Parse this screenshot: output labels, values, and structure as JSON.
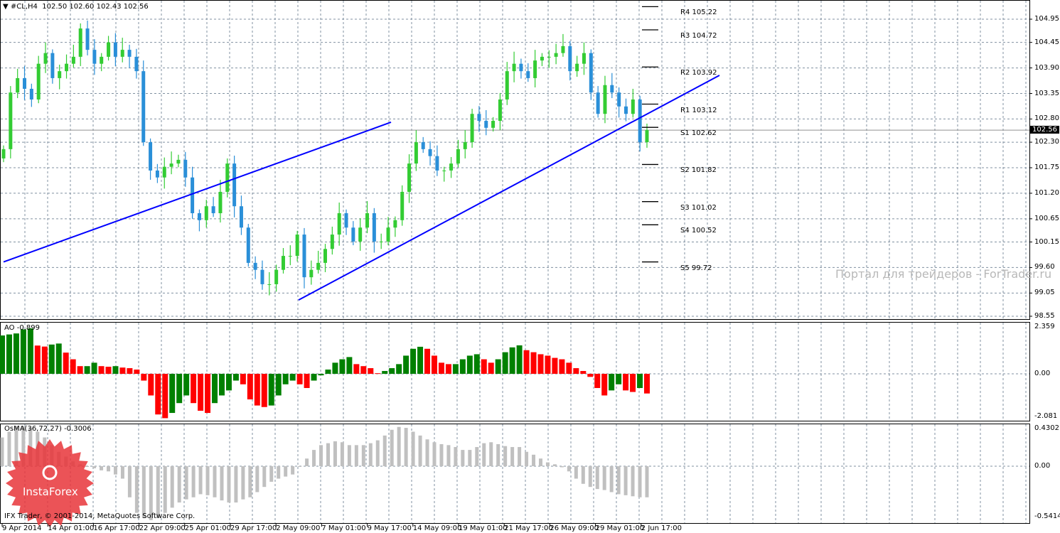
{
  "header": {
    "symbol": "#CL,H4",
    "ohlc": "102.50 102.60 102.43 102.56"
  },
  "current_price": "102.56",
  "price_axis": [
    "104.95",
    "104.45",
    "103.90",
    "103.35",
    "102.80",
    "102.30",
    "101.75",
    "101.20",
    "100.65",
    "100.15",
    "99.60",
    "99.05",
    "98.55"
  ],
  "pivots": [
    {
      "label": "R4 105.22",
      "value": 105.22
    },
    {
      "label": "R3 104.72",
      "value": 104.72
    },
    {
      "label": "R2 103.92",
      "value": 103.92
    },
    {
      "label": "R1 103.12",
      "value": 103.12
    },
    {
      "label": "S1 102.62",
      "value": 102.62
    },
    {
      "label": "S2 101.82",
      "value": 101.82
    },
    {
      "label": "S3 101.02",
      "value": 101.02
    },
    {
      "label": "S4 100.52",
      "value": 100.52
    },
    {
      "label": "S5 99.72",
      "value": 99.72
    }
  ],
  "watermark": "Портал для трейдеров - ForTrader.ru",
  "ao": {
    "label": "AO -0.899",
    "max": "2.359",
    "zero": "0.00",
    "min": "-2.081"
  },
  "osma": {
    "label": "OsMA(36,72,27) -0.3006",
    "max": "0.4302",
    "zero": "0.00",
    "min": "-0.5414"
  },
  "copyright": "IFX Trader, © 2001-2014, MetaQuotes Software Corp.",
  "logo": "InstaForex",
  "time_axis": [
    "9 Apr 2014",
    "14 Apr 01:00",
    "16 Apr 17:00",
    "22 Apr 09:00",
    "25 Apr 01:00",
    "29 Apr 17:00",
    "2 May 09:00",
    "7 May 01:00",
    "9 May 17:00",
    "14 May 09:00",
    "19 May 01:00",
    "21 May 17:00",
    "26 May 09:00",
    "29 May 01:00",
    "2 Jun 17:00"
  ],
  "colors": {
    "bull": "#33cc33",
    "bear": "#2a8fd8",
    "ao_up": "#008000",
    "ao_down": "#ff0000",
    "osma": "#c0c0c0",
    "trend": "#0000ff"
  },
  "chart_data": {
    "type": "candlestick",
    "ylim": [
      98.55,
      104.95
    ],
    "close": [
      102.15,
      103.37,
      103.68,
      103.45,
      103.22,
      103.99,
      104.22,
      103.68,
      103.83,
      103.99,
      104.14,
      104.75,
      104.29,
      103.99,
      104.14,
      104.45,
      104.14,
      104.29,
      104.14,
      103.83,
      102.3,
      101.69,
      101.54,
      101.77,
      101.84,
      101.92,
      101.54,
      100.77,
      100.62,
      100.92,
      100.77,
      101.23,
      101.84,
      100.92,
      100.46,
      99.7,
      99.55,
      99.24,
      99.24,
      99.55,
      99.85,
      99.85,
      100.31,
      99.39,
      99.55,
      99.7,
      100.0,
      100.31,
      100.77,
      100.46,
      100.16,
      100.46,
      100.77,
      100.16,
      100.16,
      100.46,
      100.62,
      101.23,
      101.84,
      102.3,
      102.15,
      102.0,
      101.69,
      101.69,
      101.84,
      102.15,
      102.3,
      102.91,
      102.76,
      102.61,
      102.76,
      103.22,
      103.83,
      103.99,
      103.83,
      103.68,
      104.06,
      104.14,
      104.14,
      104.22,
      104.37,
      103.83,
      103.99,
      104.22,
      103.37,
      102.91,
      103.53,
      103.37,
      103.07,
      102.91,
      103.22,
      102.3,
      102.56
    ],
    "trendlines": [
      {
        "from": 99.72,
        "to": 102.73
      },
      {
        "from": 98.9,
        "to": 103.74
      }
    ],
    "ao_values": [
      1.9,
      1.95,
      2.0,
      2.2,
      2.25,
      1.4,
      1.35,
      1.45,
      1.5,
      1.05,
      0.72,
      0.38,
      0.38,
      0.55,
      0.38,
      0.35,
      0.38,
      0.31,
      0.28,
      0.21,
      -0.31,
      -0.99,
      -1.86,
      -2.03,
      -1.79,
      -1.34,
      -0.99,
      -1.34,
      -1.69,
      -1.79,
      -1.34,
      -0.99,
      -0.76,
      -0.31,
      -0.48,
      -1.17,
      -1.45,
      -1.52,
      -1.45,
      -0.99,
      -0.48,
      -0.31,
      -0.48,
      -0.65,
      -0.31,
      -0.07,
      0.21,
      0.55,
      0.72,
      0.83,
      0.48,
      0.38,
      0.28,
      0.03,
      0.14,
      0.28,
      0.48,
      0.9,
      1.24,
      1.34,
      1.24,
      0.9,
      0.55,
      0.48,
      0.48,
      0.72,
      0.9,
      0.97,
      0.72,
      0.55,
      0.72,
      1.07,
      1.31,
      1.41,
      1.17,
      1.07,
      0.97,
      0.9,
      0.79,
      0.72,
      0.55,
      0.28,
      0.14,
      -0.14,
      -0.65,
      -0.99,
      -0.76,
      -0.48,
      -0.76,
      -0.83,
      -0.65,
      -0.9
    ],
    "ao_range": [
      -2.081,
      2.359
    ],
    "osma_values": [
      0.3,
      0.36,
      0.42,
      0.42,
      0.4,
      0.36,
      0.3,
      0.22,
      0.15,
      0.1,
      0.05,
      0.02,
      0.0,
      -0.02,
      -0.04,
      -0.05,
      -0.08,
      -0.12,
      -0.3,
      -0.45,
      -0.5,
      -0.52,
      -0.5,
      -0.45,
      -0.4,
      -0.35,
      -0.32,
      -0.3,
      -0.27,
      -0.28,
      -0.3,
      -0.33,
      -0.35,
      -0.35,
      -0.32,
      -0.3,
      -0.25,
      -0.2,
      -0.15,
      -0.12,
      -0.1,
      -0.08,
      0.0,
      0.08,
      0.17,
      0.22,
      0.24,
      0.26,
      0.25,
      0.22,
      0.22,
      0.22,
      0.24,
      0.27,
      0.32,
      0.38,
      0.41,
      0.4,
      0.36,
      0.32,
      0.28,
      0.25,
      0.23,
      0.22,
      0.2,
      0.17,
      0.17,
      0.2,
      0.24,
      0.25,
      0.23,
      0.21,
      0.2,
      0.2,
      0.15,
      0.12,
      0.08,
      0.04,
      0.02,
      -0.01,
      -0.05,
      -0.12,
      -0.17,
      -0.2,
      -0.22,
      -0.23,
      -0.25,
      -0.27,
      -0.28,
      -0.29,
      -0.3,
      -0.3
    ],
    "osma_range": [
      -0.5414,
      0.4302
    ]
  }
}
